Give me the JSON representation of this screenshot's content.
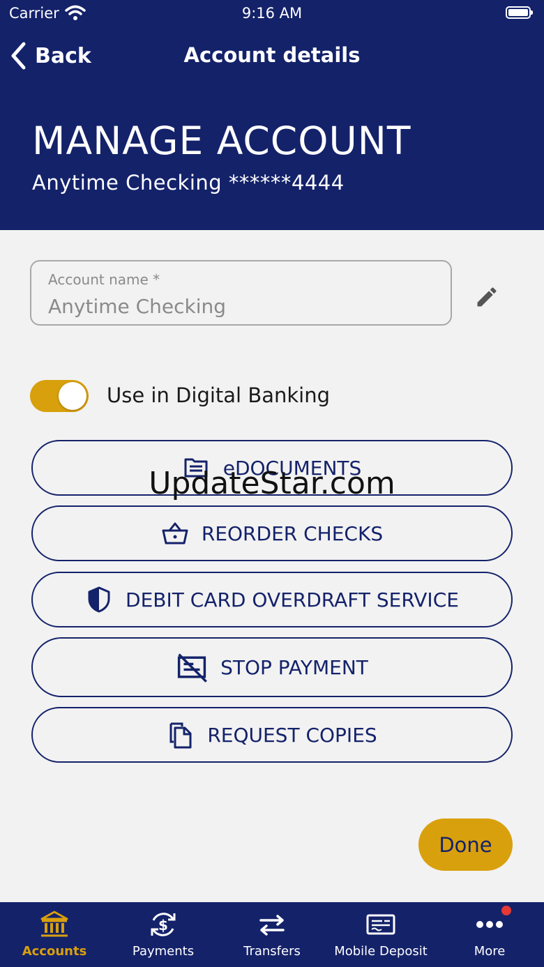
{
  "status_bar": {
    "carrier": "Carrier",
    "time": "9:16 AM"
  },
  "nav": {
    "back_label": "Back",
    "title": "Account details"
  },
  "header": {
    "title": "MANAGE ACCOUNT",
    "subtitle": "Anytime Checking ******4444"
  },
  "account_name_field": {
    "label": "Account name *",
    "value": "Anytime Checking"
  },
  "digital_banking_toggle": {
    "label": "Use in Digital Banking",
    "on": true
  },
  "actions": [
    {
      "label": "eDOCUMENTS",
      "icon": "document-icon"
    },
    {
      "label": "REORDER CHECKS",
      "icon": "basket-icon"
    },
    {
      "label": "DEBIT CARD OVERDRAFT SERVICE",
      "icon": "shield-icon"
    },
    {
      "label": "STOP PAYMENT",
      "icon": "stop-check-icon"
    },
    {
      "label": "REQUEST COPIES",
      "icon": "copy-icon"
    }
  ],
  "watermark": "UpdateStar.com",
  "done_label": "Done",
  "tabs": [
    {
      "label": "Accounts",
      "icon": "bank-icon",
      "active": true
    },
    {
      "label": "Payments",
      "icon": "payments-icon",
      "active": false
    },
    {
      "label": "Transfers",
      "icon": "transfer-arrows-icon",
      "active": false
    },
    {
      "label": "Mobile Deposit",
      "icon": "check-deposit-icon",
      "active": false
    },
    {
      "label": "More",
      "icon": "more-dots-icon",
      "active": false,
      "notification": true
    }
  ],
  "colors": {
    "primary": "#14226a",
    "accent": "#d9a00d",
    "background": "#f2f2f2",
    "notification": "#e53935"
  }
}
